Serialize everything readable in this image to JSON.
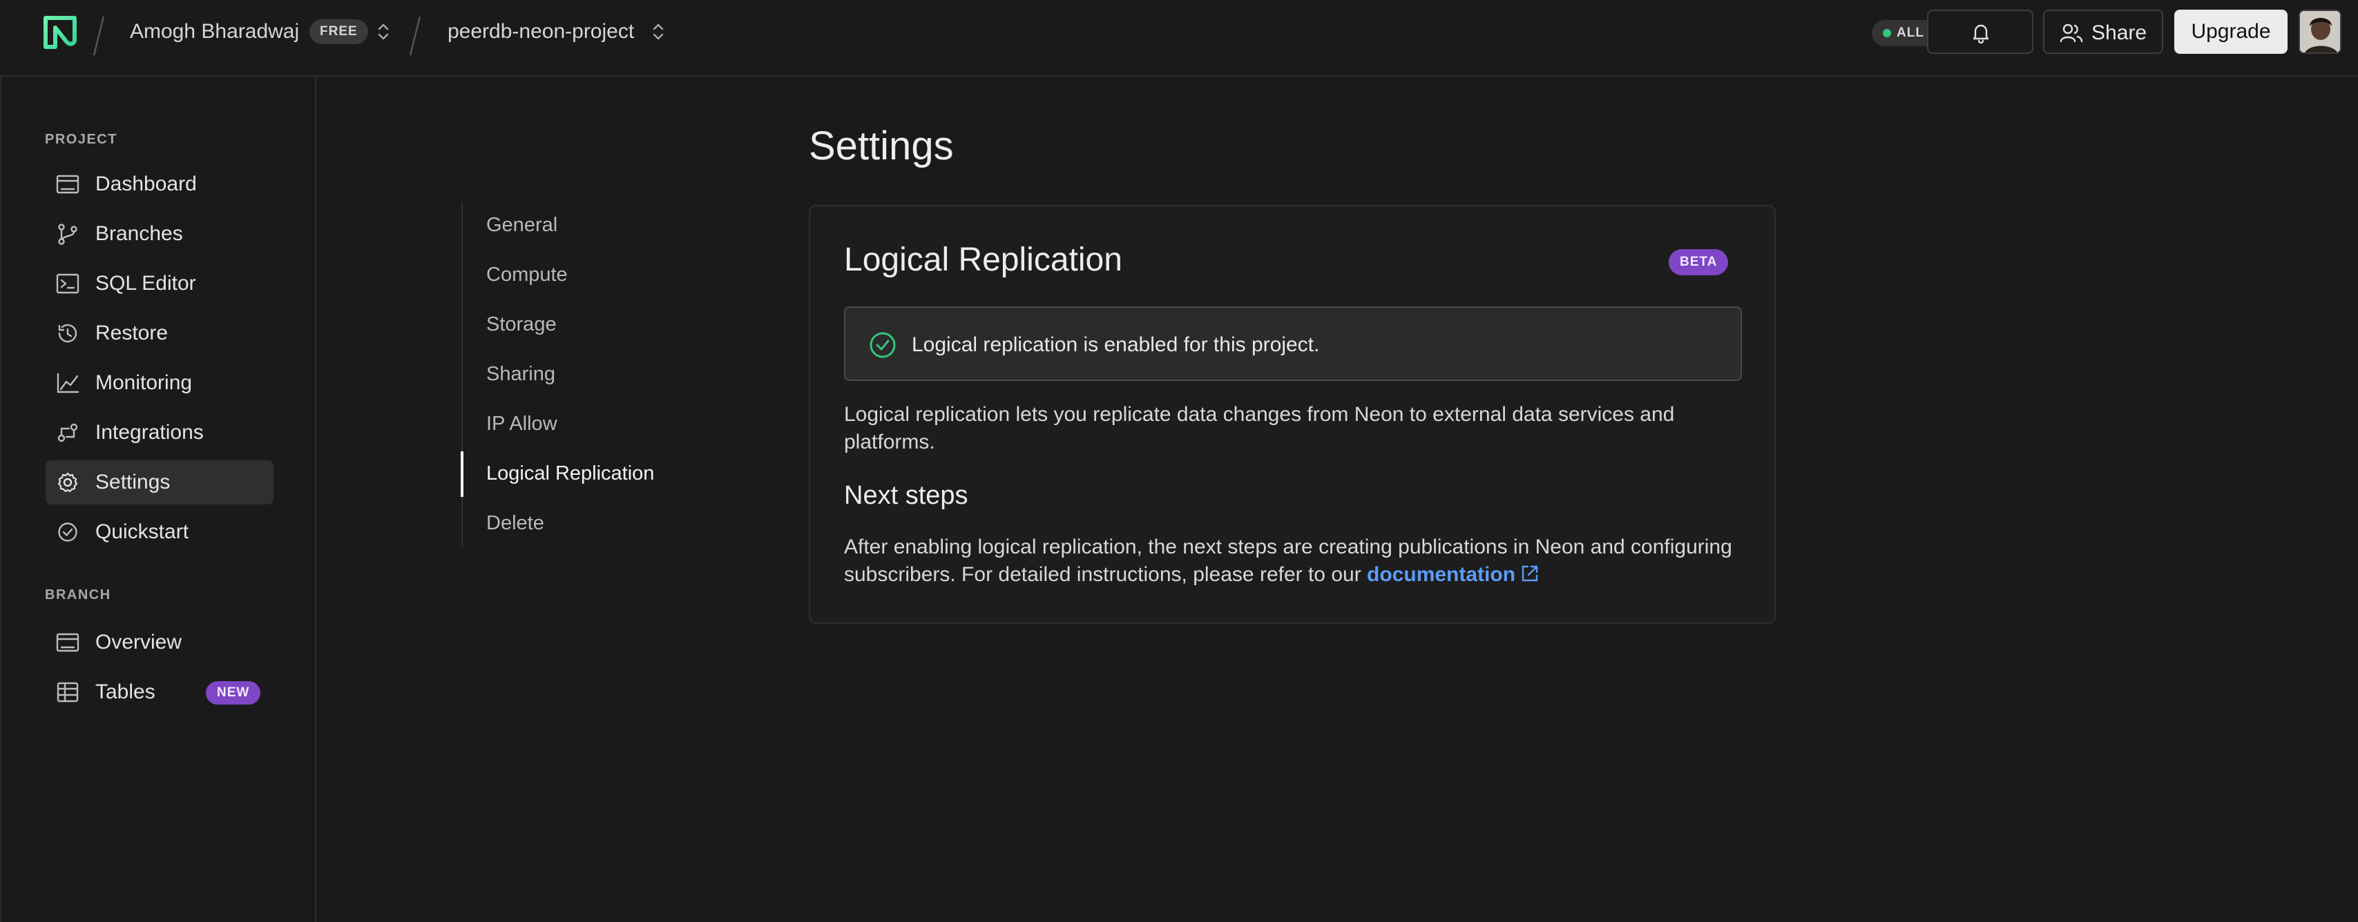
{
  "topbar": {
    "workspace_name": "Amogh Bharadwaj",
    "plan_badge": "FREE",
    "project_name": "peerdb-neon-project",
    "status": "ALL OK",
    "share_label": "Share",
    "upgrade_label": "Upgrade"
  },
  "sidebar": {
    "project_section": "PROJECT",
    "project_items": [
      {
        "label": "Dashboard"
      },
      {
        "label": "Branches"
      },
      {
        "label": "SQL Editor"
      },
      {
        "label": "Restore"
      },
      {
        "label": "Monitoring"
      },
      {
        "label": "Integrations"
      },
      {
        "label": "Settings"
      },
      {
        "label": "Quickstart"
      }
    ],
    "branch_section": "BRANCH",
    "branch_items": [
      {
        "label": "Overview"
      },
      {
        "label": "Tables",
        "badge": "NEW"
      }
    ]
  },
  "page": {
    "title": "Settings"
  },
  "settings_nav": [
    {
      "label": "General"
    },
    {
      "label": "Compute"
    },
    {
      "label": "Storage"
    },
    {
      "label": "Sharing"
    },
    {
      "label": "IP Allow"
    },
    {
      "label": "Logical Replication"
    },
    {
      "label": "Delete"
    }
  ],
  "card": {
    "title": "Logical Replication",
    "badge": "BETA",
    "status_message": "Logical replication is enabled for this project.",
    "description": "Logical replication lets you replicate data changes from Neon to external data services and platforms.",
    "next_steps_heading": "Next steps",
    "next_steps_text": "After enabling logical replication, the next steps are creating publications in Neon and configuring subscribers. For detailed instructions, please refer to our",
    "link_label": "documentation"
  },
  "colors": {
    "background": "#1a1a1a",
    "accent_green": "#34c77b",
    "badge_purple": "#7f46c6",
    "link_blue": "#5b9cf6"
  }
}
